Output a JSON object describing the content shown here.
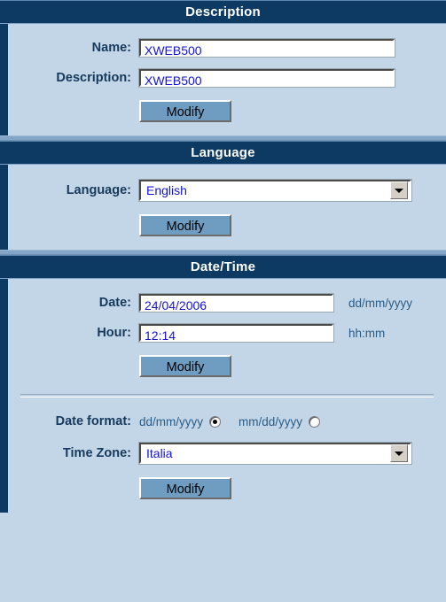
{
  "sections": {
    "description": {
      "title": "Description",
      "name_label": "Name:",
      "name_value": "XWEB500",
      "description_label": "Description:",
      "description_value": "XWEB500",
      "modify_label": "Modify"
    },
    "language": {
      "title": "Language",
      "language_label": "Language:",
      "language_value": "English",
      "modify_label": "Modify"
    },
    "datetime": {
      "title": "Date/Time",
      "date_label": "Date:",
      "date_value": "24/04/2006",
      "date_hint": "dd/mm/yyyy",
      "hour_label": "Hour:",
      "hour_value": "12:14",
      "hour_hint": "hh:mm",
      "modify_label": "Modify",
      "date_format_label": "Date format:",
      "date_format_option_1": "dd/mm/yyyy",
      "date_format_option_2": "mm/dd/yyyy",
      "date_format_selected": "dd/mm/yyyy",
      "timezone_label": "Time Zone:",
      "timezone_value": "Italia",
      "modify_label_2": "Modify"
    }
  },
  "colors": {
    "header_bar": "#0d3a63",
    "panel_body": "#c2d6e8",
    "label_text": "#16395c",
    "input_text": "#1414d2",
    "button_face": "#6f9dc2",
    "hint_text": "#2b5c86"
  }
}
